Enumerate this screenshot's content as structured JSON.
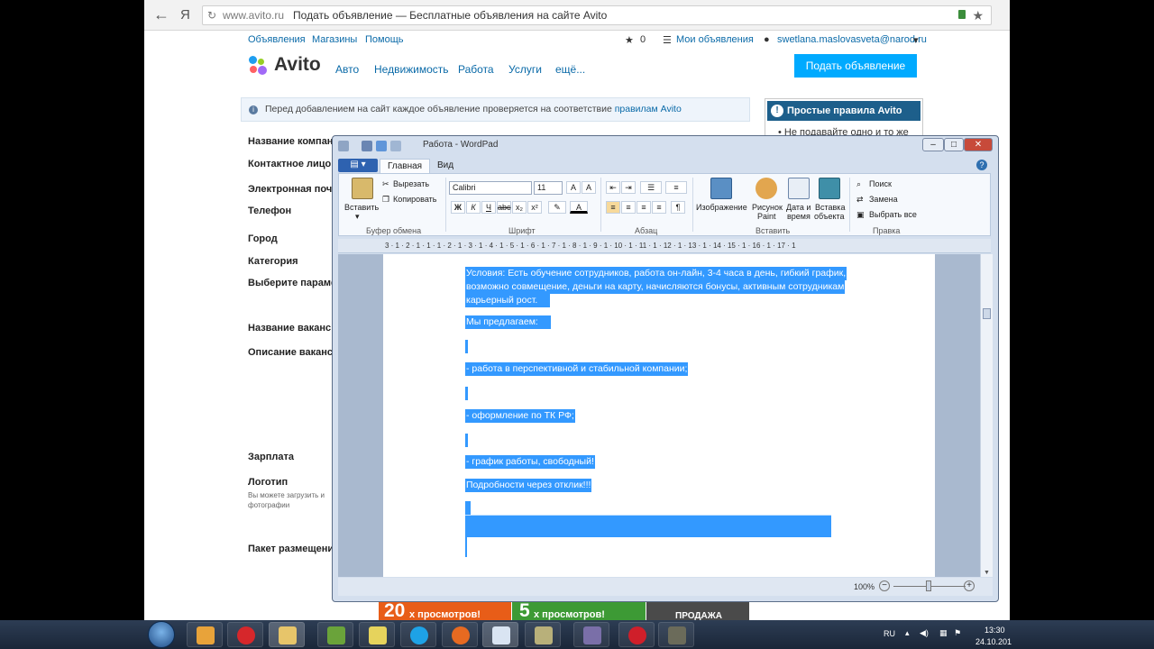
{
  "browser": {
    "url_host": "www.avito.ru",
    "page_title": "Подать объявление — Бесплатные объявления на сайте Avito",
    "yandex_label": "Я"
  },
  "avito": {
    "top_links": [
      "Объявления",
      "Магазины",
      "Помощь"
    ],
    "favorites_count": "0",
    "my_ads": "Мои объявления",
    "user_email": "swetlana.maslovasveta@narod.ru",
    "logo_text": "Avito",
    "nav": [
      "Авто",
      "Недвижимость",
      "Работа",
      "Услуги",
      "ещё..."
    ],
    "post_button": "Подать объявление",
    "notice_text": "Перед добавлением на сайт каждое объявление проверяется на соответствие ",
    "notice_link": "правилам Avito",
    "rules_title": "Простые правила Avito",
    "rules_text": "• Не подавайте одно и то же",
    "form_labels": [
      "Название компан",
      "Контактное лицо",
      "Электронная почт",
      "Телефон",
      "Город",
      "Категория",
      "Выберите параме",
      "Название ваканс",
      "Описание ваканс",
      "Зарплата",
      "Логотип",
      "Пакет размещения"
    ],
    "logo_note": "Вы можете загрузить и фотографии",
    "packages": [
      {
        "num": "20",
        "text": "х просмотров!"
      },
      {
        "num": "5",
        "text": "х просмотров!"
      },
      {
        "num": "",
        "text": "ПРОДАЖА"
      }
    ]
  },
  "wordpad": {
    "title": "Работа - WordPad",
    "tabs": [
      "Главная",
      "Вид"
    ],
    "clipboard": {
      "paste": "Вставить",
      "cut": "Вырезать",
      "copy": "Копировать",
      "group": "Буфер обмена"
    },
    "font": {
      "name": "Calibri",
      "size": "11",
      "group": "Шрифт",
      "buttons": [
        "Ж",
        "К",
        "Ч",
        "abc",
        "x₂",
        "x²"
      ]
    },
    "paragraph_group": "Абзац",
    "insert": {
      "image": "Изображение",
      "paint_1": "Рисунок",
      "paint_2": "Paint",
      "date_1": "Дата и",
      "date_2": "время",
      "obj_1": "Вставка",
      "obj_2": "объекта",
      "group": "Вставить"
    },
    "editing": {
      "find": "Поиск",
      "replace": "Замена",
      "select_all": "Выбрать все",
      "group": "Правка"
    },
    "ruler": "3 · 1 · 2 · 1 · 1 · 1 · 2 · 1 · 3 · 1 · 4 · 1 · 5 · 1 · 6 · 1 · 7 · 1 · 8 · 1 · 9 · 1 · 10 · 1 · 11 · 1 · 12 · 1 · 13 · 1 · 14 · 15 · 1 · 16 · 1 · 17 · 1",
    "doc_lines": [
      "Условия: Есть обучение сотрудников, работа он-лайн, 3-4 часа в день, гибкий график,",
      "возможно совмещение, деньги на карту, начисляются бонусы, активным сотрудникам",
      "карьерный рост.",
      "Мы предлагаем:",
      "- работа в перспективной и стабильной компании;",
      "- оформление по ТК РФ;",
      "- график работы, свободный!",
      "Подробности через отклик!!!"
    ],
    "zoom": "100%"
  },
  "taskbar": {
    "lang": "RU",
    "time": "13:30",
    "date": "24.10.201"
  }
}
